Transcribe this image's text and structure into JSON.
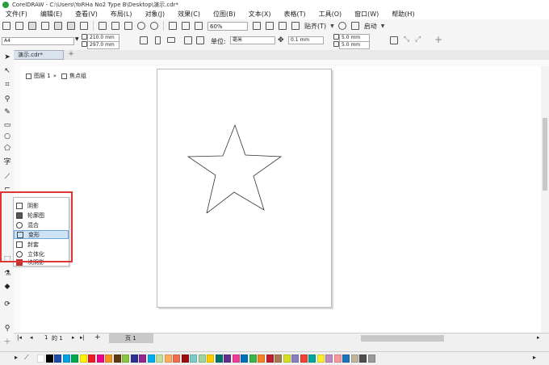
{
  "title": "CorelDRAW - C:\\Users\\YoRHa No2 Type B\\Desktop\\演示.cdr*",
  "menu": [
    "文件(F)",
    "编辑(E)",
    "查看(V)",
    "布局(L)",
    "对象(J)",
    "效果(C)",
    "位图(B)",
    "文本(X)",
    "表格(T)",
    "工具(O)",
    "窗口(W)",
    "帮助(H)"
  ],
  "toolbar": {
    "zoom": "60%",
    "snap_label": "贴齐(T)",
    "launch_label": "启动"
  },
  "property_bar": {
    "page_size": "A4",
    "width": "210.0 mm",
    "height": "297.0 mm",
    "unit_label": "单位:",
    "unit": "毫米",
    "nudge": "0.1 mm",
    "dup_x": "5.0 mm",
    "dup_y": "5.0 mm"
  },
  "tab": {
    "name": "演示.cdr*"
  },
  "breadcrumb": {
    "layer": "图层 1",
    "group": "焦点组"
  },
  "flyout": {
    "items": [
      {
        "label": "阴影",
        "icon": "shadow-icon"
      },
      {
        "label": "轮廓图",
        "icon": "contour-icon"
      },
      {
        "label": "混合",
        "icon": "blend-icon"
      },
      {
        "label": "变形",
        "icon": "distort-icon",
        "selected": true
      },
      {
        "label": "封套",
        "icon": "envelope-icon"
      },
      {
        "label": "立体化",
        "icon": "extrude-icon"
      },
      {
        "label": "块阴影",
        "icon": "block-shadow-icon"
      }
    ]
  },
  "page_nav": {
    "current": "1",
    "of_label": "的 1",
    "page_tab": "页 1"
  },
  "palette_colors": [
    "#ffffff",
    "#000000",
    "#1f4aa8",
    "#00a0e6",
    "#00a651",
    "#fff200",
    "#ed1c24",
    "#ec008c",
    "#f7941d",
    "#603913",
    "#8dc63f",
    "#2e3192",
    "#92278f",
    "#00aeef",
    "#c4df9b",
    "#fbaf5d",
    "#f26c4f",
    "#9e0b0f",
    "#7accc8",
    "#a3d39c",
    "#ffcc00",
    "#00746b",
    "#662d91",
    "#ee3d96",
    "#0072bc",
    "#39b54a",
    "#f58220",
    "#be1e2d",
    "#a67c52",
    "#d7df23",
    "#8781bd",
    "#ef4136",
    "#00a99d",
    "#f9ed32",
    "#bd8cbf",
    "#f6989d",
    "#1c75bc",
    "#c2b59b",
    "#4d4d4d",
    "#999999"
  ]
}
